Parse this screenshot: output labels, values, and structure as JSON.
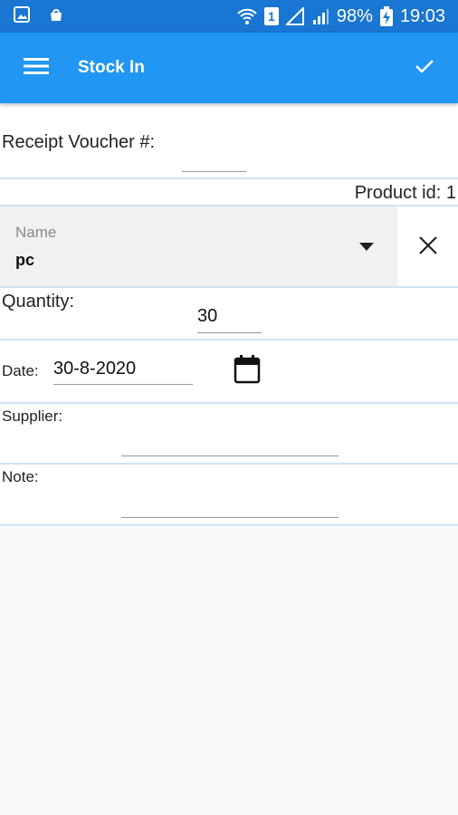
{
  "status_bar": {
    "battery": "98%",
    "time": "19:03",
    "sim": "1",
    "icons": [
      "image-icon",
      "bag-icon",
      "wifi-icon",
      "sim-icon",
      "signal-icon",
      "signal-icon",
      "battery-charging-icon"
    ]
  },
  "app_bar": {
    "title": "Stock In",
    "menu_icon": "menu-icon",
    "save_icon": "check-icon"
  },
  "form": {
    "receipt_voucher_label": "Receipt Voucher #:",
    "receipt_voucher_value": "",
    "product_id_text": "Product id: 1",
    "name_label": "Name",
    "name_value": "pc",
    "quantity_label": "Quantity:",
    "quantity_value": "30",
    "date_label": "Date:",
    "date_value": "30-8-2020",
    "supplier_label": "Supplier:",
    "supplier_value": "",
    "note_label": "Note:",
    "note_value": ""
  },
  "colors": {
    "status_bar": "#1976d2",
    "app_bar": "#2196f3",
    "divider": "#cfe3f6"
  }
}
